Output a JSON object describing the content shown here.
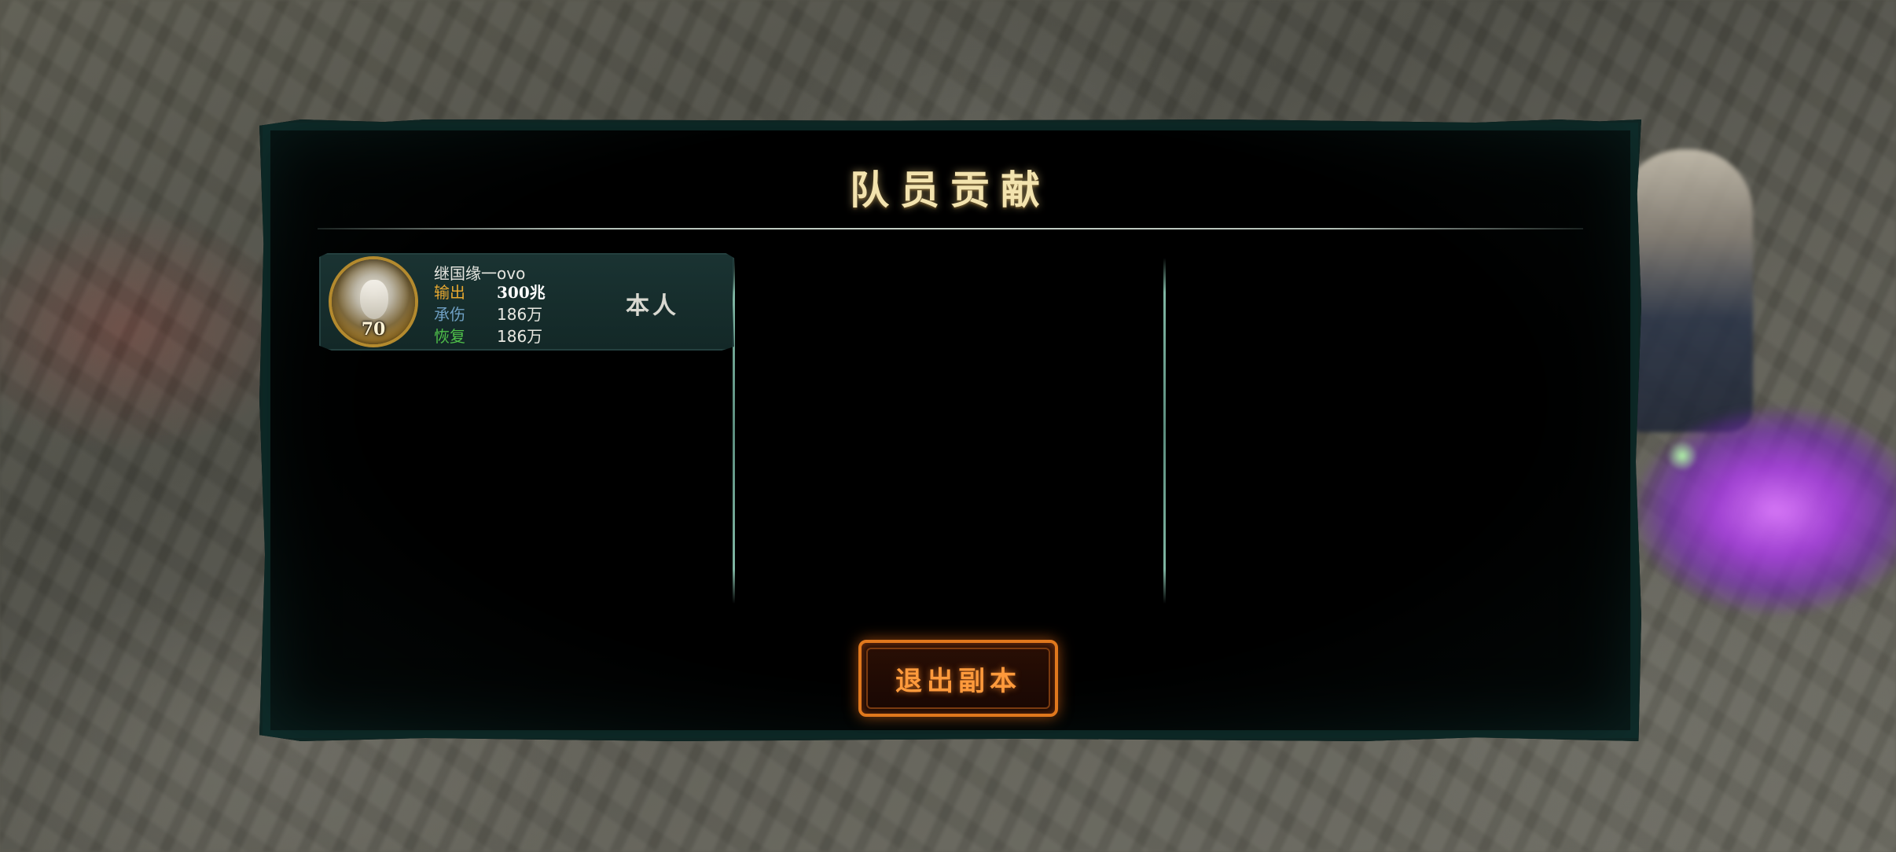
{
  "background": {
    "hud_text": ""
  },
  "dialog": {
    "title": "队员贡献",
    "exit_button_label": "退出副本"
  },
  "members": [
    {
      "name": "继国缘一ovo",
      "level": "70",
      "tag": "本人",
      "stats": {
        "output_label": "输出",
        "output_value": "300兆",
        "tank_label": "承伤",
        "tank_value": "186万",
        "heal_label": "恢复",
        "heal_value": "186万"
      }
    }
  ],
  "colors": {
    "title": "#f3e3ae",
    "output_label": "#e5a730",
    "tank_label": "#6fa0c4",
    "heal_label": "#4fc04a",
    "button_accent": "#e0781d",
    "panel_border": "#0e2523"
  },
  "icons": {
    "avatar": "player-portrait-icon"
  }
}
